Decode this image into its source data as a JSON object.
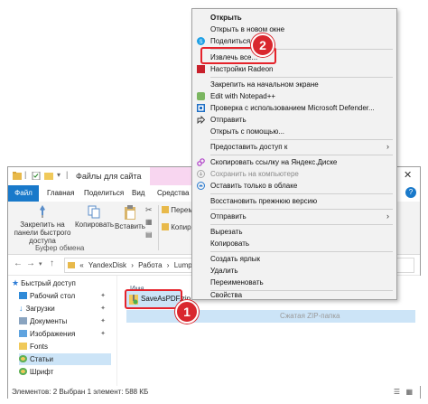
{
  "window": {
    "title": "Файлы для сайта",
    "tabs": [
      "Файл",
      "Главная",
      "Поделиться",
      "Вид",
      "Средства раб"
    ],
    "help": "?",
    "ribbon": {
      "pin_label": "Закрепить на панели быстрого доступа",
      "copy_label": "Копировать",
      "paste_label": "Вставить",
      "move_label": "Перемест",
      "copy2_label": "Копирова",
      "group_label": "Буфер обмена"
    },
    "address": {
      "crumbs": [
        "«",
        "YandexDisk",
        "›",
        "Работа",
        "›",
        "Lumpics.ru"
      ]
    },
    "nav": [
      {
        "label": "Быстрый доступ",
        "icon": "star-icon",
        "pinned": false
      },
      {
        "label": "Рабочий стол",
        "icon": "folder-blue-icon",
        "pinned": true
      },
      {
        "label": "Загрузки",
        "icon": "download-icon",
        "pinned": true
      },
      {
        "label": "Документы",
        "icon": "documents-icon",
        "pinned": true
      },
      {
        "label": "Изображения",
        "icon": "pictures-icon",
        "pinned": true
      },
      {
        "label": "Fonts",
        "icon": "folder-icon",
        "pinned": false
      },
      {
        "label": "Статьи",
        "icon": "folder-sync-icon",
        "pinned": false
      },
      {
        "label": "Шрифт",
        "icon": "folder-sync-icon",
        "pinned": false
      }
    ],
    "column_header": "Имя",
    "files": [
      {
        "name": "SaveAsPDF.zip",
        "date": "",
        "type": "Сжатая ZIP-папка",
        "size": "",
        "selected": true
      }
    ],
    "status": "Элементов: 2    Выбран 1 элемент: 588 КБ"
  },
  "context_menu": {
    "items": [
      {
        "label": "Открыть",
        "bold": true,
        "icon": ""
      },
      {
        "label": "Открыть в новом окне",
        "icon": ""
      },
      {
        "label": "Поделиться в",
        "icon": "skype-icon"
      },
      {
        "sep": true
      },
      {
        "label": "Извлечь все...",
        "icon": ""
      },
      {
        "label": "Настройки Radeon",
        "icon": "radeon-icon"
      },
      {
        "sep": true
      },
      {
        "label": "Закрепить на начальном экране",
        "icon": ""
      },
      {
        "label": "Edit with Notepad++",
        "icon": "notepad-icon"
      },
      {
        "label": "Проверка с использованием Microsoft Defender...",
        "icon": "defender-icon"
      },
      {
        "label": "Отправить",
        "icon": "share-icon"
      },
      {
        "label": "Открыть с помощью...",
        "icon": ""
      },
      {
        "sep": true
      },
      {
        "label": "Предоставить доступ к",
        "icon": "",
        "submenu": true
      },
      {
        "sep": true
      },
      {
        "label": "Скопировать ссылку на Яндекс.Диске",
        "icon": "link-icon"
      },
      {
        "label": "Сохранить на компьютере",
        "icon": "save-icon",
        "disabled": true
      },
      {
        "label": "Оставить только в облаке",
        "icon": "cloud-icon"
      },
      {
        "sep": true
      },
      {
        "label": "Восстановить прежнюю версию",
        "icon": ""
      },
      {
        "sep": true
      },
      {
        "label": "Отправить",
        "icon": "",
        "submenu": true
      },
      {
        "sep": true
      },
      {
        "label": "Вырезать",
        "icon": ""
      },
      {
        "label": "Копировать",
        "icon": ""
      },
      {
        "sep": true
      },
      {
        "label": "Создать ярлык",
        "icon": ""
      },
      {
        "label": "Удалить",
        "icon": ""
      },
      {
        "label": "Переименовать",
        "icon": ""
      },
      {
        "sep": true
      },
      {
        "label": "Свойства",
        "icon": ""
      }
    ]
  },
  "badges": {
    "step1": "1",
    "step2": "2"
  },
  "colors": {
    "accent": "#1979ca",
    "highlight": "#e5232b",
    "selection": "#cce4f7",
    "menu_bg": "#f2f2f2"
  }
}
